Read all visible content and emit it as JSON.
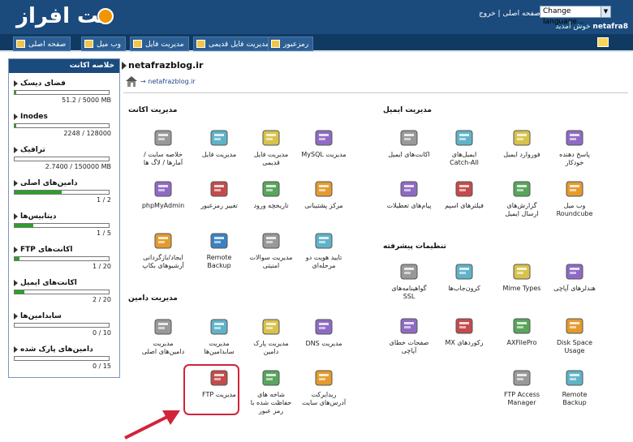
{
  "header": {
    "logo_text": "نت افراز",
    "links": {
      "home": "صفحه اصلی",
      "sep": " | ",
      "logout": "خروج"
    },
    "language": "Change language...",
    "welcome_user": "netafra8",
    "welcome_text": "خوش آمدید"
  },
  "nav": {
    "tabs": [
      {
        "label": "صفحه اصلی"
      },
      {
        "label": "وب میل"
      },
      {
        "label": "مدیریت فایل"
      },
      {
        "label": "مدیریت فایل قدیمی"
      },
      {
        "label": "رمزعبور"
      }
    ]
  },
  "sidebar": {
    "title": "خلاصه اکانت",
    "stats": [
      {
        "label": "فضای دیسک",
        "value": "51.2 / 5000 MB",
        "fill": 0.01
      },
      {
        "label": "Inodes",
        "value": "2248 / 128000",
        "fill": 0.02
      },
      {
        "label": "ترافیک",
        "value": "2.7400 / 150000 MB",
        "fill": 0.0
      },
      {
        "label": "دامین‌های اصلی",
        "value": "1 / 2",
        "fill": 0.5
      },
      {
        "label": "دیتابیس‌ها",
        "value": "1 / 5",
        "fill": 0.2
      },
      {
        "label": "اکانت‌های FTP",
        "value": "1 / 20",
        "fill": 0.05
      },
      {
        "label": "اکانت‌های ایمیل",
        "value": "2 / 20",
        "fill": 0.1
      },
      {
        "label": "سابدامین‌ها",
        "value": "0 / 10",
        "fill": 0.0
      },
      {
        "label": "دامین‌های پارک شده",
        "value": "0 / 15",
        "fill": 0.0
      }
    ]
  },
  "main": {
    "domain": "netafrazblog.ir",
    "breadcrumb": "→ netafrazblog.ir",
    "account_title": "مدیریت اکانت",
    "email_title": "مدیریت ایمیل",
    "advanced_title": "تنظیمات پیشرفته",
    "domain_title": "مدیریت دامین",
    "account_items": [
      "مدیریت MySQL",
      "مدیریت فایل قدیمی",
      "مدیریت فایل",
      "خلاصه سایت / آمارها / لاگ ها",
      "مرکز پشتیبانی",
      "تاریخچه ورود",
      "تغییر رمزعبور",
      "phpMyAdmin",
      "تایید هویت دو مرحله‌ای",
      "مدیریت سوالات امنیتی",
      "Remote Backup",
      "ایجاد/بازگردانی آرشیوهای بکاپ"
    ],
    "email_items": [
      "پاسخ دهنده خودکار",
      "فوروارد ایمیل",
      "ایمیل‌های Catch-All",
      "اکانت‌های ایمیل",
      "وب میل Roundcube",
      "گزارش‌های ارسال ایمیل",
      "فیلترهای اسپم",
      "پیام‌های تعطیلات"
    ],
    "advanced_items": [
      "هندلرهای آپاچی",
      "Mime Types",
      "کرون‌جاب‌ها",
      "گواهینامه‌های SSL",
      "Disk Space Usage",
      "AXFilePro",
      "رکوردهای MX",
      "صفحات خطای آپاچی",
      "Remote Backup",
      "FTP Access Manager"
    ],
    "domain_items": [
      "مدیریت DNS",
      "مدیریت پارک دامین",
      "مدیریت سابدامین‌ها",
      "مدیریت دامین‌های اصلی",
      "ریدایرکت آدرس‌های سایت",
      "شاخه های حفاظت شده با رمز عبور",
      "مدیریت FTP"
    ]
  },
  "colors": {
    "header": "#1b4a7d",
    "nav": "#113a63",
    "highlight": "#d1233a",
    "bar": "#2aa02a"
  }
}
